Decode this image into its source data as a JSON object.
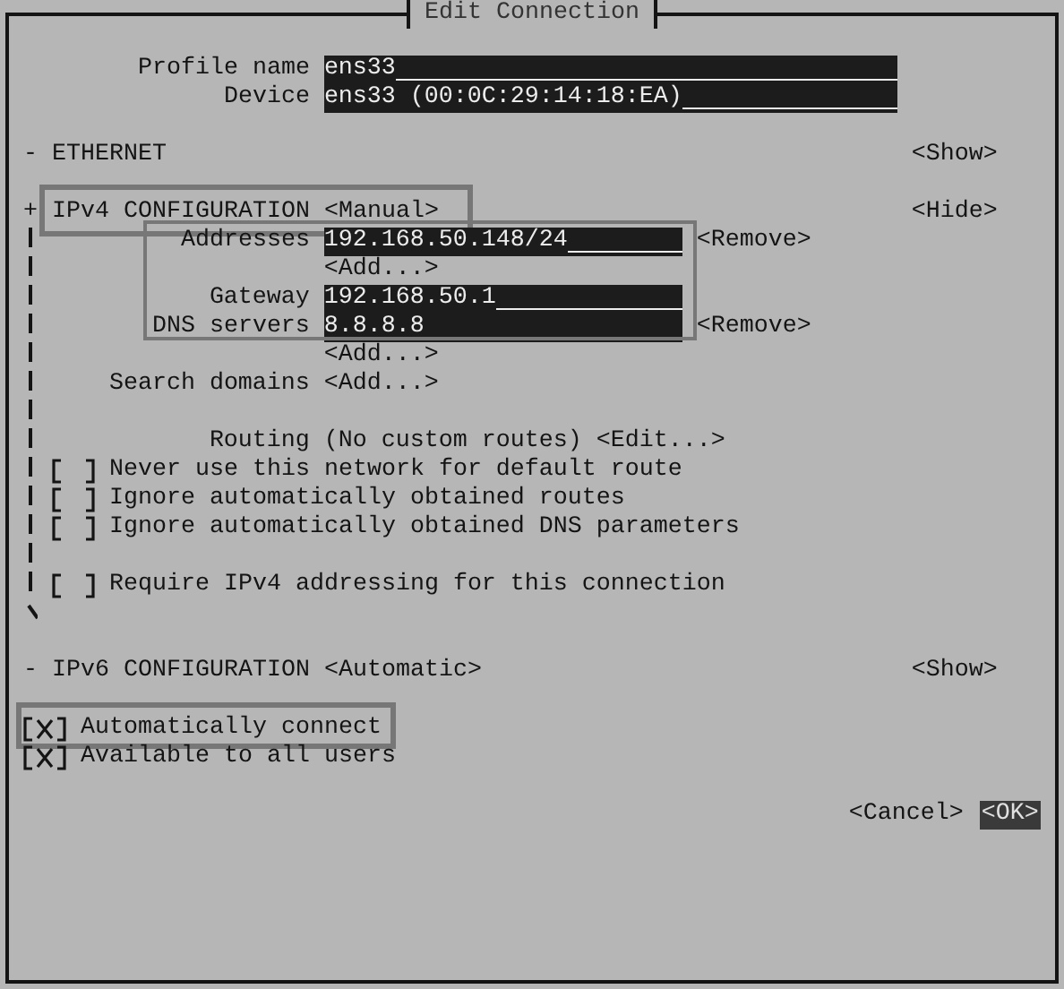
{
  "window": {
    "title": "Edit Connection"
  },
  "profile": {
    "label": "Profile name",
    "value": "ens33"
  },
  "device": {
    "label": "Device",
    "value": "ens33 (00:0C:29:14:18:EA)"
  },
  "sections": [
    {
      "marker": "-",
      "title": "ETHERNET",
      "toggle": "<Show>"
    },
    {
      "marker": "+",
      "title": "IPv4 CONFIGURATION",
      "mode": "<Manual>",
      "toggle": "<Hide>",
      "expanded": true,
      "highlighted": true,
      "addresses": {
        "label": "Addresses",
        "items": [
          {
            "value": "192.168.50.148/24",
            "remove": "<Remove>"
          }
        ],
        "add": "<Add...>"
      },
      "gateway": {
        "label": "Gateway",
        "value": "192.168.50.1"
      },
      "dns": {
        "label": "DNS servers",
        "items": [
          {
            "value": "8.8.8.8",
            "remove": "<Remove>"
          }
        ],
        "add": "<Add...>"
      },
      "fields_highlighted": true,
      "search_domains": {
        "label": "Search domains",
        "add": "<Add...>"
      },
      "routing": {
        "label": "Routing",
        "value": "(No custom routes)",
        "edit": "<Edit...>"
      },
      "options": [
        {
          "label": "Never use this network for default route",
          "checked": false
        },
        {
          "label": "Ignore automatically obtained routes",
          "checked": false
        },
        {
          "label": "Ignore automatically obtained DNS parameters",
          "checked": false
        }
      ],
      "require": {
        "label": "Require IPv4 addressing for this connection",
        "checked": false
      }
    },
    {
      "marker": "-",
      "title": "IPv6 CONFIGURATION",
      "mode": "<Automatic>",
      "toggle": "<Show>"
    }
  ],
  "general_options": [
    {
      "label": "Automatically connect",
      "checked": true,
      "highlighted": true
    },
    {
      "label": "Available to all users",
      "checked": true,
      "highlighted": false
    }
  ],
  "buttons": [
    {
      "label": "<Cancel>",
      "selected": false
    },
    {
      "label": "<OK>",
      "selected": true
    }
  ]
}
